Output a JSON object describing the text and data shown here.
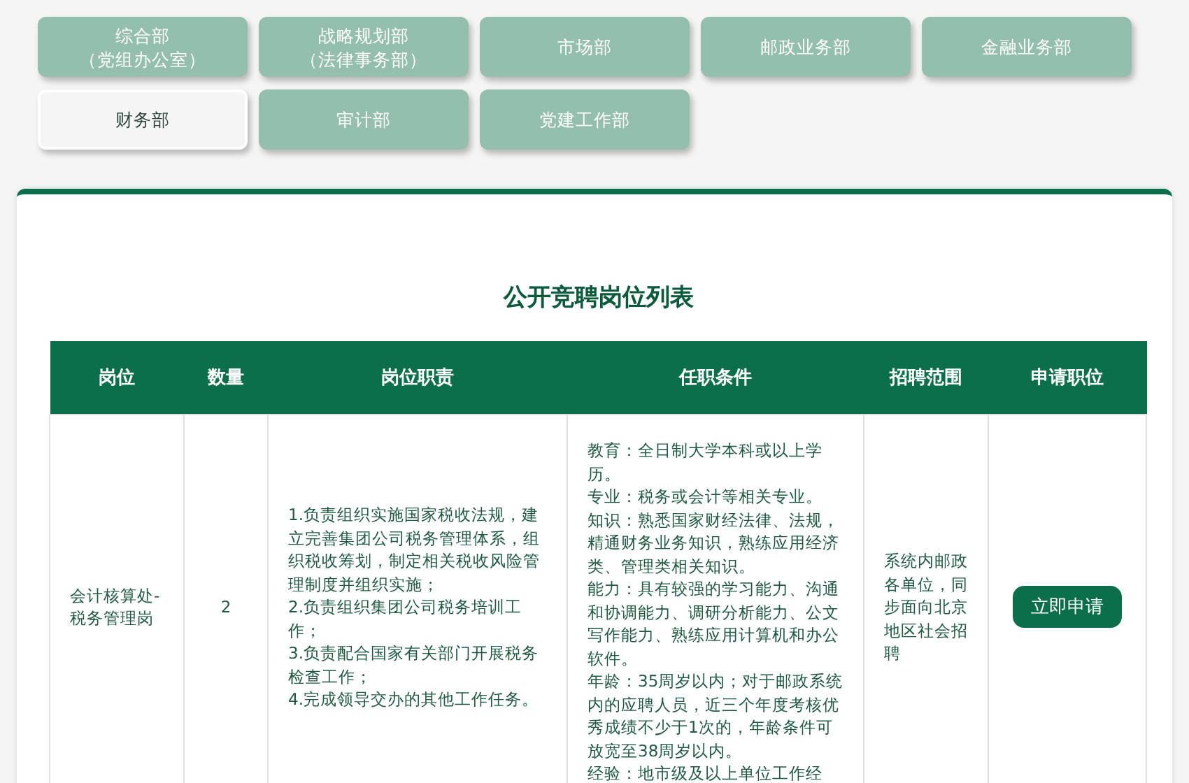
{
  "tabs": [
    {
      "label": "综合部",
      "sublabel": "（党组办公室）",
      "selected": false
    },
    {
      "label": "战略规划部",
      "sublabel": "（法律事务部）",
      "selected": false
    },
    {
      "label": "市场部",
      "selected": false
    },
    {
      "label": "邮政业务部",
      "selected": false
    },
    {
      "label": "金融业务部",
      "selected": false
    },
    {
      "label": "财务部",
      "selected": true
    },
    {
      "label": "审计部",
      "selected": false
    },
    {
      "label": "党建工作部",
      "selected": false
    }
  ],
  "panel": {
    "title": "公开竞聘岗位列表",
    "table": {
      "columns": [
        "岗位",
        "数量",
        "岗位职责",
        "任职条件",
        "招聘范围",
        "申请职位"
      ],
      "rows": [
        {
          "position": "会计核算处-税务管理岗",
          "count": "2",
          "duties": [
            "1.负责组织实施国家税收法规，建立完善集团公司税务管理体系，组织税收筹划，制定相关税收风险管理制度并组织实施；",
            "2.负责组织集团公司税务培训工作；",
            "3.负责配合国家有关部门开展税务检查工作；",
            "4.完成领导交办的其他工作任务。"
          ],
          "requirements": [
            "教育：全日制大学本科或以上学历。",
            "专业：税务或会计等相关专业。",
            "知识：熟悉国家财经法律、法规，精通财务业务知识，熟练应用经济类、管理类相关知识。",
            "能力：具有较强的学习能力、沟通和协调能力、调研分析能力、公文写作能力、熟练应用计算机和办公软件。",
            "年龄：35周岁以内；对于邮政系统内的应聘人员，近三个年度考核优秀成绩不少于1次的，年龄条件可放宽至38周岁以内。",
            "经验：地市级及以上单位工作经"
          ],
          "scope": "系统内邮政各单位，同步面向北京地区社会招聘",
          "apply": "立即申请"
        }
      ]
    }
  }
}
